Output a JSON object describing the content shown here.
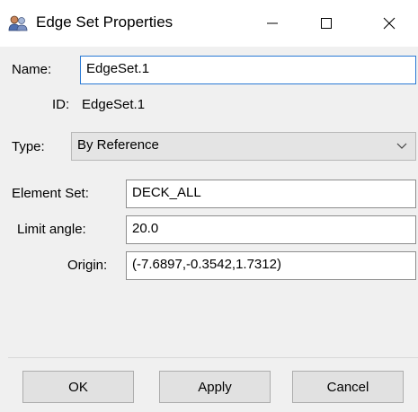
{
  "window": {
    "title": "Edge Set Properties",
    "icons": {
      "app": "edge-set-icon",
      "minimize": "minimize-icon",
      "maximize": "maximize-icon",
      "close": "close-icon"
    }
  },
  "form": {
    "name_label": "Name:",
    "name_value": "EdgeSet.1",
    "id_label": "ID:",
    "id_value": "EdgeSet.1",
    "type_label": "Type:",
    "type_value": "By Reference",
    "element_set_label": "Element Set:",
    "element_set_value": "DECK_ALL",
    "limit_angle_label": "Limit angle:",
    "limit_angle_value": "20.0",
    "origin_label": "Origin:",
    "origin_value": "(-7.6897,-0.3542,1.7312)"
  },
  "buttons": {
    "ok": "OK",
    "apply": "Apply",
    "cancel": "Cancel"
  },
  "colors": {
    "focus_border": "#2a7ad5",
    "panel_bg": "#f0f0f0",
    "button_bg": "#e1e1e1"
  }
}
